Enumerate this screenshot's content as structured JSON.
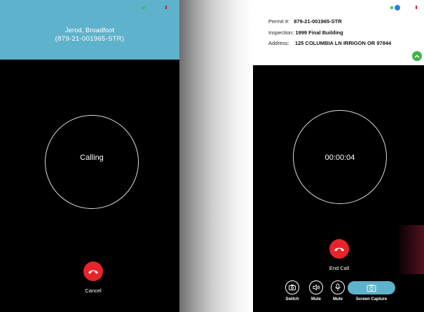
{
  "left": {
    "caller_name": "Jerod, Broadfoot",
    "caller_id": "(879-21-001965-STR)",
    "status": "Calling",
    "cancel_label": "Cancel"
  },
  "right": {
    "permit_label": "Permit #:",
    "permit_value": "879-21-001965-STR",
    "inspection_label": "Inspection:",
    "inspection_value": "1999 Final Building",
    "address_label": "Address:",
    "address_value": "125 COLUMBIA LN IRRIGON OR 97844",
    "timer": "00:00:04",
    "end_call_label": "End Call",
    "controls": {
      "switch": "Switch",
      "mute_speaker": "Mute",
      "mute_mic": "Mute",
      "screen_capture": "Screen Capture"
    }
  },
  "colors": {
    "header_blue": "#5fb2cb",
    "end_call_red": "#e8242b",
    "status_green": "#22c55e",
    "expand_green": "#3fb24a",
    "location_blue": "#2d7fe0"
  },
  "icons": [
    "phone-end-icon",
    "chevron-up-icon",
    "switch-camera-icon",
    "speaker-icon",
    "microphone-icon",
    "camera-icon",
    "location-icon"
  ]
}
